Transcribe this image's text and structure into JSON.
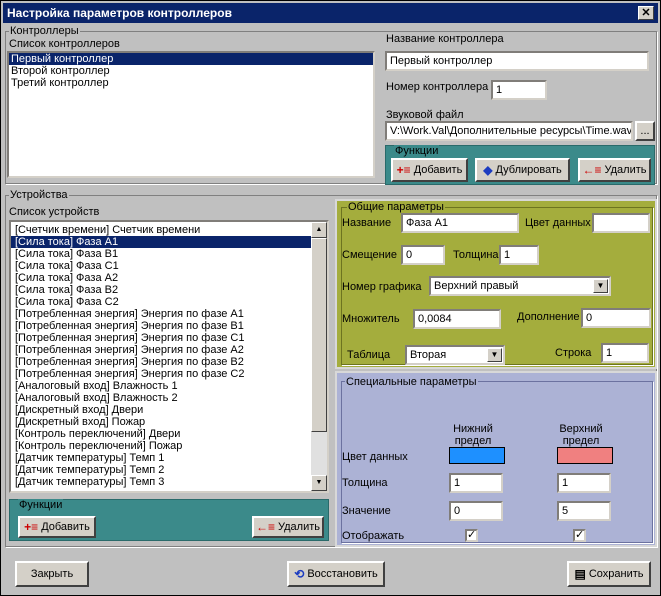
{
  "window": {
    "title": "Настройка параметров контроллеров",
    "close": "✕"
  },
  "controllers": {
    "group_title": "Контроллеры",
    "list_label": "Список контроллеров",
    "items": [
      "Первый контроллер",
      "Второй контроллер",
      "Третий контроллер"
    ],
    "name_label": "Название контроллера",
    "name_value": "Первый контроллер",
    "number_label": "Номер контроллера",
    "number_value": "1",
    "sound_label": "Звуковой файл",
    "sound_value": "V:\\Work.Val\\Дополнительные ресурсы\\Time.wav",
    "browse": "...",
    "functions_title": "Функции",
    "add": "Добавить",
    "duplicate": "Дублировать",
    "delete": "Удалить"
  },
  "devices": {
    "group_title": "Устройства",
    "list_label": "Список устройств",
    "items": [
      "[Счетчик времени]  Счетчик времени",
      "[Сила тока]  Фаза А1",
      "[Сила тока]  Фаза В1",
      "[Сила тока]  Фаза С1",
      "[Сила тока]  Фаза А2",
      "[Сила тока]  Фаза В2",
      "[Сила тока]  Фаза С2",
      "[Потребленная энергия]  Энергия по фазе А1",
      "[Потребленная энергия]  Энергия по фазе В1",
      "[Потребленная энергия]  Энергия по фазе С1",
      "[Потребленная энергия]  Энергия по фазе А2",
      "[Потребленная энергия]  Энергия по фазе В2",
      "[Потребленная энергия]  Энергия по фазе С2",
      "[Аналоговый вход]  Влажность 1",
      "[Аналоговый вход]  Влажность 2",
      "[Дискретный вход]  Двери",
      "[Дискретный вход]  Пожар",
      "[Контроль переключений]  Двери",
      "[Контроль переключений]  Пожар",
      "[Датчик температуры]  Темп 1",
      "[Датчик температуры]  Темп 2",
      "[Датчик температуры]  Темп 3"
    ],
    "selected_index": 1,
    "functions_title": "Функции",
    "add": "Добавить",
    "delete": "Удалить"
  },
  "general": {
    "title": "Общие параметры",
    "name_label": "Название",
    "name_value": "Фаза А1",
    "color_label": "Цвет данных",
    "offset_label": "Смещение",
    "offset_value": "0",
    "thickness_label": "Толщина",
    "thickness_value": "1",
    "graph_label": "Номер графика",
    "graph_value": "Верхний правый",
    "multiplier_label": "Множитель",
    "multiplier_value": "0,0084",
    "addition_label": "Дополнение",
    "addition_value": "0",
    "table_label": "Таблица",
    "table_value": "Вторая",
    "row_label": "Строка",
    "row_value": "1"
  },
  "special": {
    "title": "Специальные параметры",
    "lower": "Нижний предел",
    "upper": "Верхний предел",
    "color_label": "Цвет данных",
    "lower_color": "#1e90ff",
    "upper_color": "#f08080",
    "thickness_label": "Толщина",
    "lower_thickness": "1",
    "upper_thickness": "1",
    "value_label": "Значение",
    "lower_value": "0",
    "upper_value": "5",
    "show_label": "Отображать",
    "check": "✓"
  },
  "footer": {
    "close": "Закрыть",
    "restore": "Восстановить",
    "save": "Сохранить"
  }
}
